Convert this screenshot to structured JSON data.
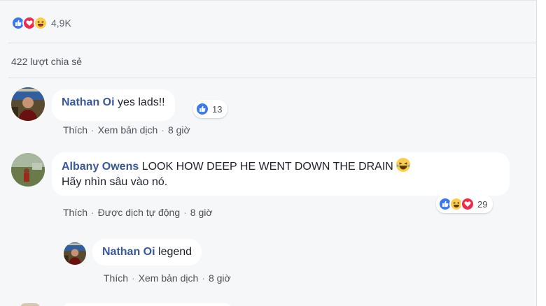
{
  "post": {
    "reaction_total": "4,9K",
    "share_count": "422 lượt chia sẻ",
    "reaction_icons": [
      "like-icon",
      "love-icon",
      "haha-icon"
    ]
  },
  "comments": [
    {
      "author": "Nathan Oi",
      "text": "yes lads!!",
      "reaction_count": "13",
      "actions": {
        "like": "Thích",
        "translate": "Xem bản dịch",
        "time": "8 giờ"
      }
    },
    {
      "author": "Albany Owens",
      "text": "LOOK HOW DEEP HE WENT DOWN THE DRAIN",
      "translation": "Hãy nhìn sâu vào nó.",
      "reaction_count": "29",
      "actions": {
        "like": "Thích",
        "auto_translated": "Được dịch tự động",
        "time": "8 giờ"
      }
    }
  ],
  "reply": {
    "author": "Nathan Oi",
    "text": "legend",
    "actions": {
      "like": "Thích",
      "translate": "Xem bản dịch",
      "time": "8 giờ"
    }
  },
  "colors": {
    "link_blue": "#385898",
    "like_blue": "#3b77f3",
    "love_red": "#f0284a",
    "haha_yellow": "#fbcd4a",
    "background": "#f6f7f9"
  }
}
